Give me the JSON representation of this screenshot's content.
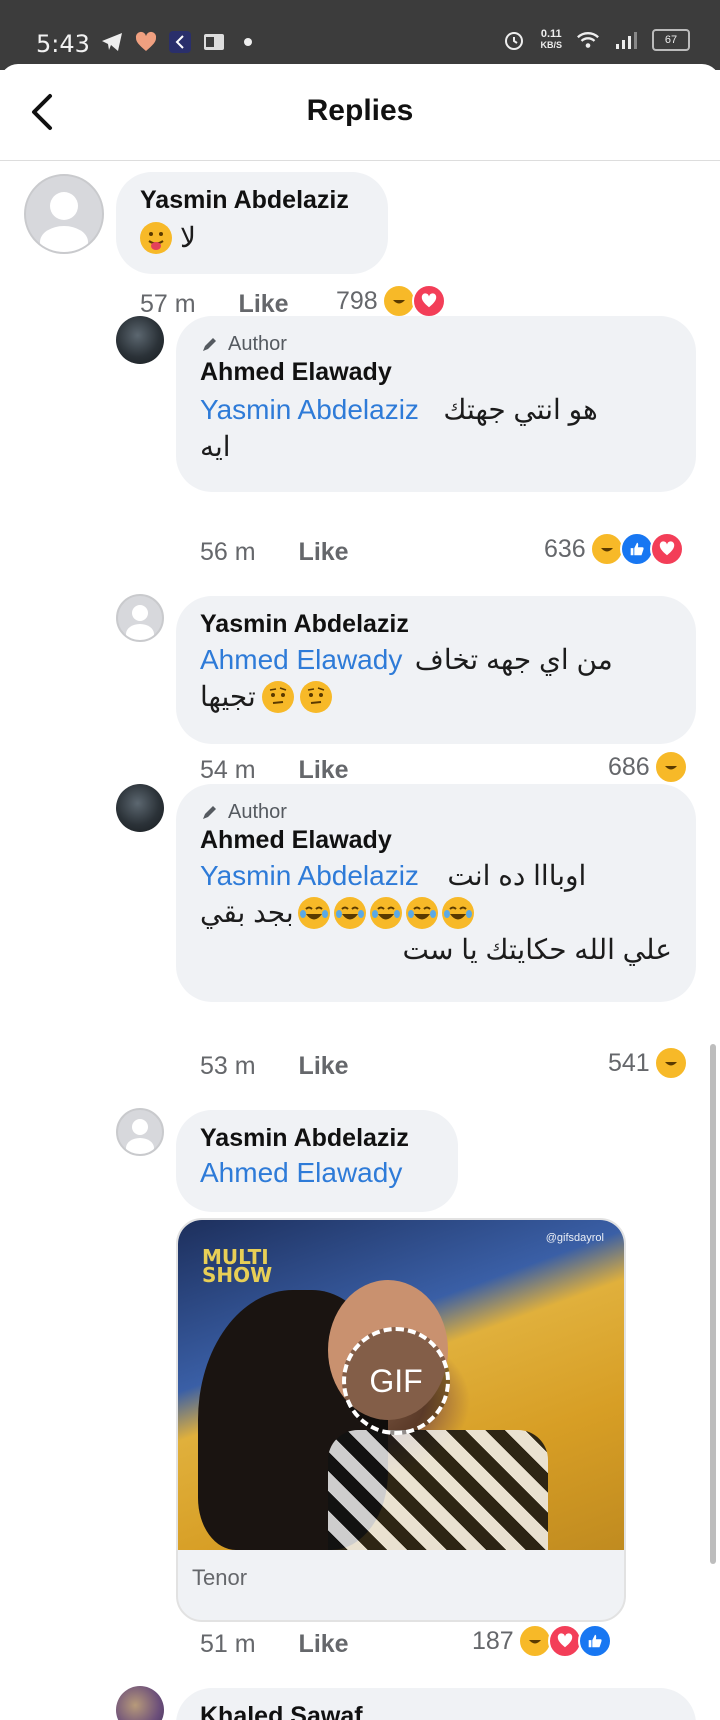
{
  "status_bar": {
    "time": "5:43",
    "net_speed_value": "0.11",
    "net_speed_unit": "KB/S",
    "battery": "67"
  },
  "header": {
    "title": "Replies"
  },
  "comments": [
    {
      "name": "Yasmin Abdelaziz",
      "text": "لا",
      "time": "57 m",
      "like": "Like",
      "reactions": "798"
    },
    {
      "author_tag": "Author",
      "name": "Ahmed Elawady",
      "mention": "Yasmin Abdelaziz",
      "text_line1": "هو انتي جهتك",
      "text_line2": "ايه",
      "time": "56 m",
      "like": "Like",
      "reactions": "636"
    },
    {
      "name": "Yasmin Abdelaziz",
      "mention": "Ahmed Elawady",
      "text_line1": "من اي جهه تخاف",
      "text_line2": "تجيها",
      "time": "54 m",
      "like": "Like",
      "reactions": "686"
    },
    {
      "author_tag": "Author",
      "name": "Ahmed Elawady",
      "mention": "Yasmin Abdelaziz",
      "text_line1": "اوبااا ده انت",
      "text_line2": "بجد بقي",
      "text_line3": "علي الله حكايتك يا ست",
      "time": "53 m",
      "like": "Like",
      "reactions": "541"
    },
    {
      "name": "Yasmin Abdelaziz",
      "mention": "Ahmed Elawady",
      "gif_label": "GIF",
      "gif_brand": "MULTI SHOW",
      "gif_watermark": "@gifsdayrol",
      "gif_source": "Tenor",
      "time": "51 m",
      "like": "Like",
      "reactions": "187"
    },
    {
      "name": "Khaled Sawaf"
    }
  ]
}
